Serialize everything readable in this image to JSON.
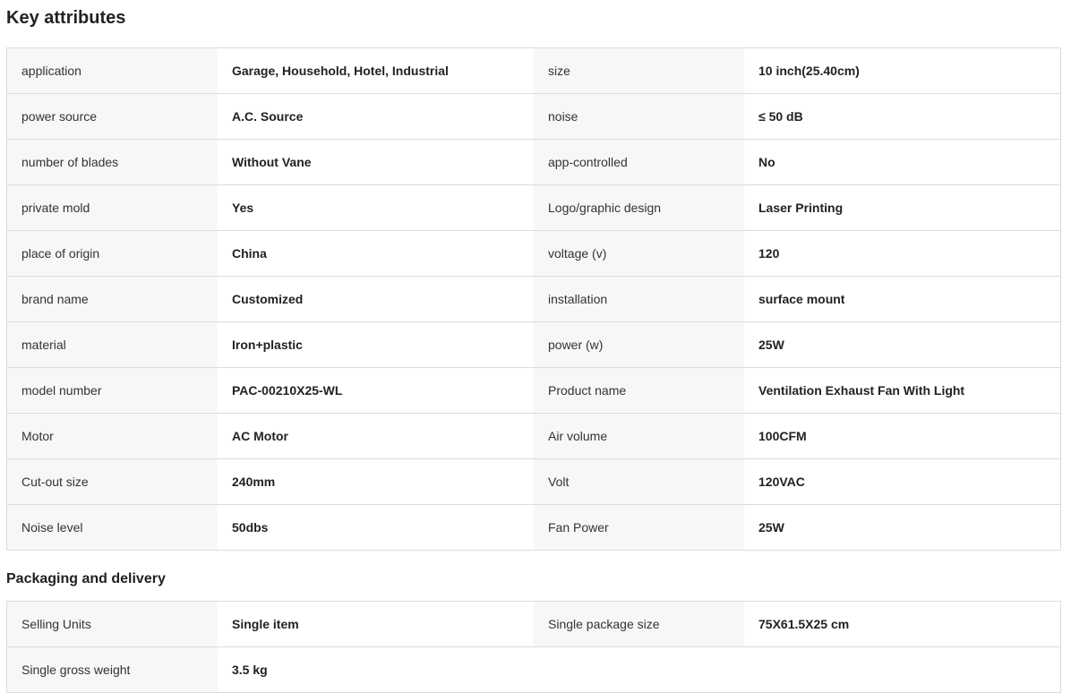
{
  "key_attributes": {
    "title": "Key attributes",
    "rows": [
      {
        "l1": "application",
        "v1": "Garage, Household, Hotel, Industrial",
        "l2": "size",
        "v2": "10 inch(25.40cm)"
      },
      {
        "l1": "power source",
        "v1": "A.C. Source",
        "l2": "noise",
        "v2": "≤ 50 dB"
      },
      {
        "l1": "number of blades",
        "v1": "Without Vane",
        "l2": "app-controlled",
        "v2": "No"
      },
      {
        "l1": "private mold",
        "v1": "Yes",
        "l2": "Logo/graphic design",
        "v2": "Laser Printing"
      },
      {
        "l1": "place of origin",
        "v1": "China",
        "l2": "voltage (v)",
        "v2": "120"
      },
      {
        "l1": "brand name",
        "v1": "Customized",
        "l2": "installation",
        "v2": "surface mount"
      },
      {
        "l1": "material",
        "v1": "Iron+plastic",
        "l2": "power (w)",
        "v2": "25W"
      },
      {
        "l1": "model number",
        "v1": "PAC-00210X25-WL",
        "l2": "Product name",
        "v2": "Ventilation Exhaust Fan With Light"
      },
      {
        "l1": "Motor",
        "v1": "AC Motor",
        "l2": "Air volume",
        "v2": "100CFM"
      },
      {
        "l1": "Cut-out size",
        "v1": "240mm",
        "l2": "Volt",
        "v2": "120VAC"
      },
      {
        "l1": "Noise level",
        "v1": "50dbs",
        "l2": "Fan Power",
        "v2": "25W"
      }
    ]
  },
  "packaging": {
    "title": "Packaging and delivery",
    "rows": [
      {
        "l1": "Selling Units",
        "v1": "Single item",
        "l2": "Single package size",
        "v2": "75X61.5X25 cm"
      },
      {
        "l1": "Single gross weight",
        "v1": "3.5 kg",
        "l2": "",
        "v2": ""
      }
    ]
  }
}
